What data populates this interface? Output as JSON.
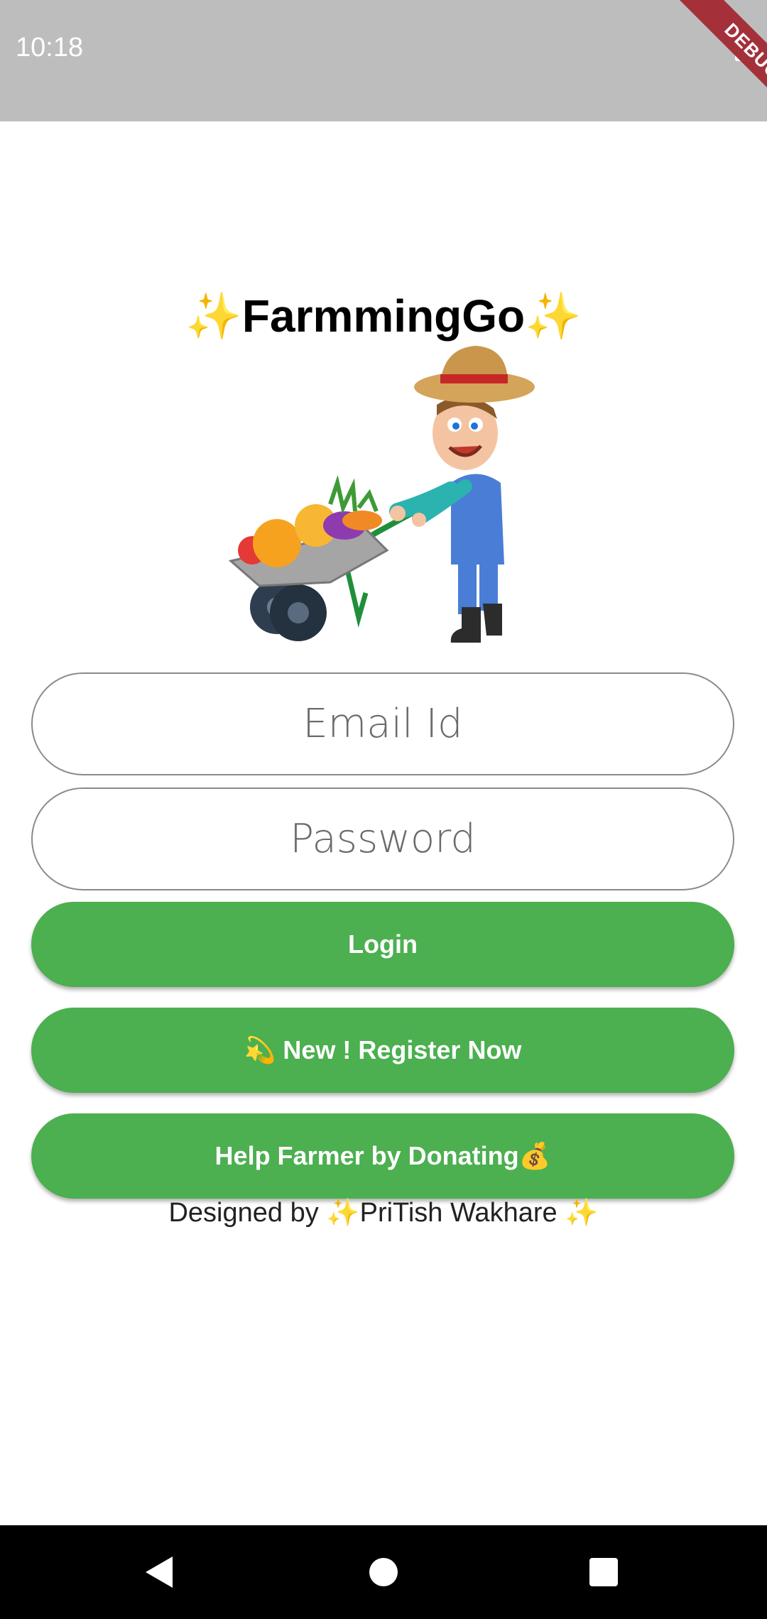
{
  "status_bar": {
    "time": "10:18",
    "debug_label": "DEBUG"
  },
  "app": {
    "title": "✨FarmmingGo✨",
    "illustration": "farmer-with-wheelbarrow-illustration"
  },
  "form": {
    "email_placeholder": "Email Id",
    "password_placeholder": "Password"
  },
  "buttons": {
    "login": "Login",
    "register": "💫 New ! Register Now",
    "donate": "Help Farmer by Donating💰"
  },
  "footer": {
    "credit": "Designed by ✨PriTish Wakhare ✨"
  },
  "colors": {
    "accent": "#4caf50",
    "status_bar": "#bdbdbd",
    "debug_ribbon": "#a4303a"
  },
  "nav_bar": {
    "icons": [
      "back-icon",
      "home-icon",
      "recents-icon"
    ]
  }
}
